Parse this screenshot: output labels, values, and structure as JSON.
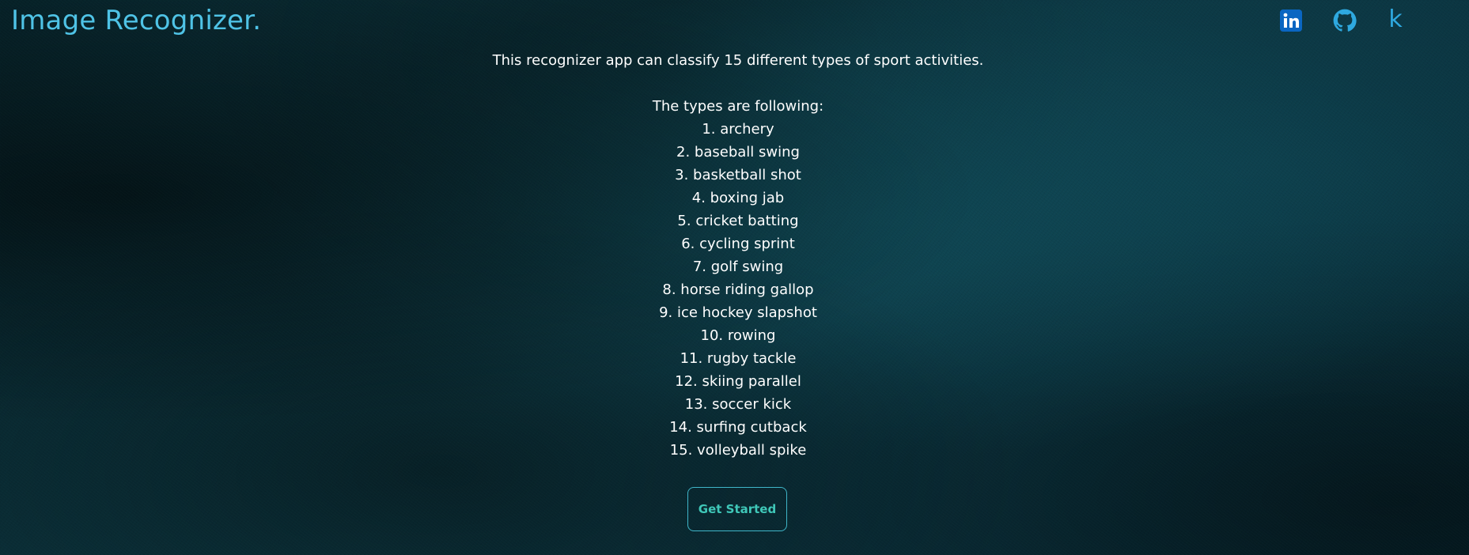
{
  "header": {
    "brand": "Image Recognizer.",
    "social_links": [
      {
        "name": "linkedin",
        "icon": "linkedin-icon",
        "color": "#0a66c2"
      },
      {
        "name": "github",
        "icon": "github-icon",
        "color": "#2ea9e0"
      },
      {
        "name": "kaggle",
        "icon": "kaggle-icon",
        "glyph": "k",
        "color": "#2ea9e0"
      }
    ]
  },
  "main": {
    "intro": "This recognizer app can classify 15 different types of sport activities.",
    "types_heading": "The types are following:",
    "types": [
      "1. archery",
      "2. baseball swing",
      "3. basketball shot",
      "4. boxing jab",
      "5. cricket batting",
      "6. cycling sprint",
      "7. golf swing",
      "8. horse riding gallop",
      "9. ice hockey slapshot",
      "10. rowing",
      "11. rugby tackle",
      "12. skiing parallel",
      "13. soccer kick",
      "14. surfing cutback",
      "15. volleyball spike"
    ],
    "cta_label": "Get Started"
  },
  "colors": {
    "brand": "#4fc3e6",
    "accent": "#3fc7b8",
    "background": "#0a2b33"
  }
}
